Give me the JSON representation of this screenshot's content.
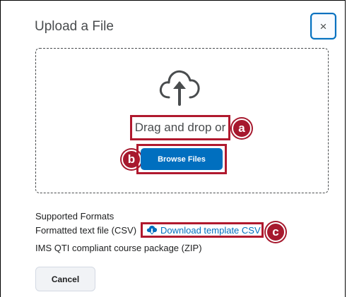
{
  "dialog": {
    "title": "Upload a File",
    "close_label": "×"
  },
  "dropzone": {
    "drag_text": "Drag and drop or",
    "browse_label": "Browse Files"
  },
  "callouts": {
    "a": "a",
    "b": "b",
    "c": "c"
  },
  "formats": {
    "heading": "Supported Formats",
    "csv_text": "Formatted text file (CSV)",
    "download_link": "Download template CSV",
    "zip_text": "IMS QTI compliant course package (ZIP)"
  },
  "footer": {
    "cancel_label": "Cancel"
  },
  "colors": {
    "accent": "#006fbf",
    "callout": "#a6192e"
  },
  "icons": {
    "upload": "cloud-upload-icon",
    "download": "cloud-download-icon"
  }
}
